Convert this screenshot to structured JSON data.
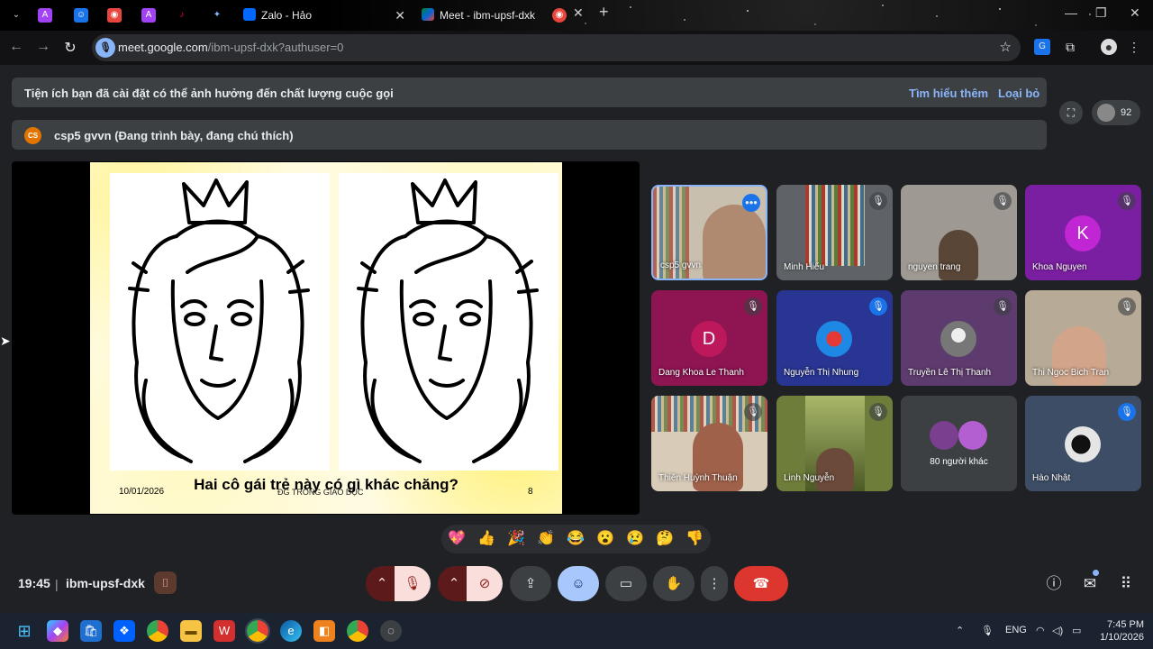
{
  "browser": {
    "tabs": [
      {
        "label": "Zalo - Hảo",
        "active": false
      },
      {
        "label": "Meet - ibm-upsf-dxk",
        "active": true
      }
    ],
    "url_host": "meet.google.com",
    "url_path": "/ibm-upsf-dxk?authuser=0"
  },
  "banners": {
    "extension_warning": "Tiện ích bạn đã cài đặt có thể ảnh hưởng đến chất lượng cuộc gọi",
    "learn_more": "Tìm hiểu thêm",
    "dismiss": "Loại bỏ",
    "presenter_initials": "CS",
    "presenter_text": "csp5 gvvn (Đang trình bày, đang chú thích)"
  },
  "participant_count": "92",
  "slide": {
    "title": "Hai cô gái trẻ này có gì khác chăng?",
    "date": "10/01/2026",
    "footer": "ĐG TRONG GIÁO DỤC",
    "page": "8"
  },
  "participants": [
    {
      "name": "csp5 gvvn",
      "kind": "video"
    },
    {
      "name": "Minh Hiếu",
      "kind": "video"
    },
    {
      "name": "nguyen trang",
      "kind": "video"
    },
    {
      "name": "Khoa Nguyen",
      "kind": "letter",
      "letter": "K",
      "color": "#c026d3"
    },
    {
      "name": "Dang Khoa Le Thanh",
      "kind": "letter",
      "letter": "D",
      "color": "#be185d"
    },
    {
      "name": "Nguyễn Thị Nhung",
      "kind": "photo"
    },
    {
      "name": "Truyền Lê Thị Thanh",
      "kind": "photo"
    },
    {
      "name": "Thi Ngoc Bich Tran",
      "kind": "video"
    },
    {
      "name": "Thiên Huỳnh Thuận",
      "kind": "video"
    },
    {
      "name": "Linh Nguyễn",
      "kind": "video"
    },
    {
      "name": "80 người khác",
      "kind": "group"
    },
    {
      "name": "Hào Nhật",
      "kind": "photo"
    }
  ],
  "reactions": [
    "💖",
    "👍",
    "🎉",
    "👏",
    "😂",
    "😮",
    "😢",
    "🤔",
    "👎"
  ],
  "meeting": {
    "time": "19:45",
    "separator": "|",
    "code": "ibm-upsf-dxk"
  },
  "taskbar": {
    "lang": "ENG",
    "clock_time": "7:45 PM",
    "clock_date": "1/10/2026"
  },
  "colors": {
    "end_call": "#dc362e",
    "accent_blue": "#8ab4f8",
    "mic_off_bg": "#f9dedc"
  }
}
